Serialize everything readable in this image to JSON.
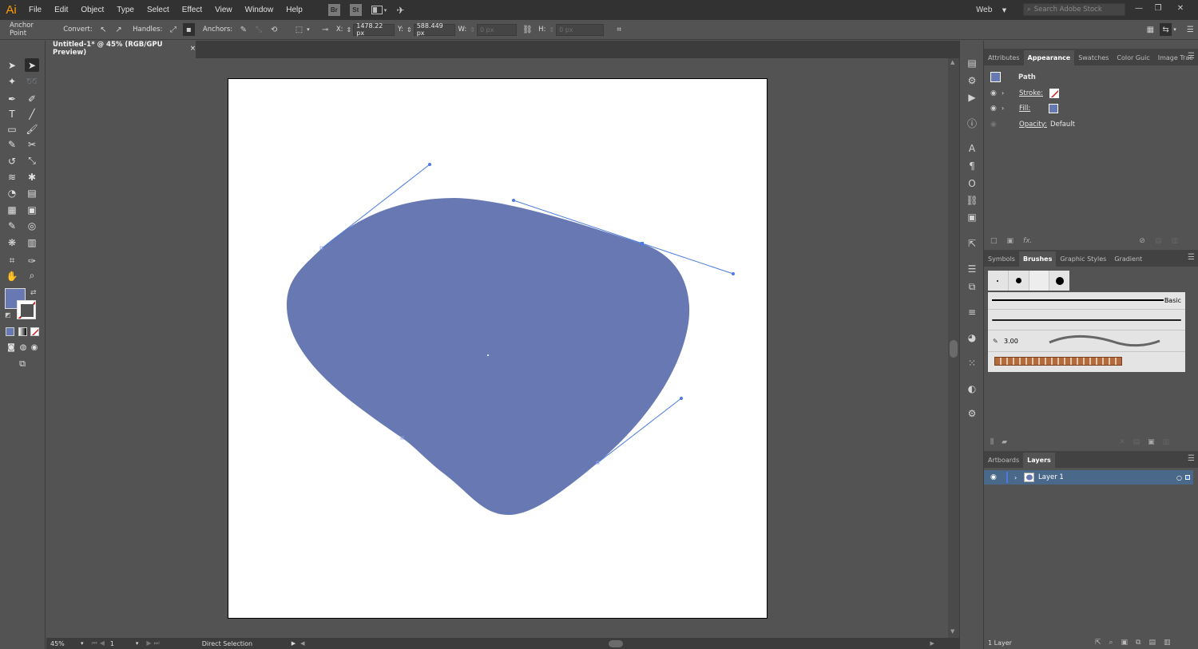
{
  "app": {
    "logo": "Ai",
    "accent": "#ff9a00"
  },
  "menu": [
    "File",
    "Edit",
    "Object",
    "Type",
    "Select",
    "Effect",
    "View",
    "Window",
    "Help"
  ],
  "menu_icons": {
    "bridge": "Br",
    "stock": "St"
  },
  "workspace": {
    "label": "Web"
  },
  "search": {
    "placeholder": "Search Adobe Stock"
  },
  "control": {
    "mode": "Anchor Point",
    "convert_label": "Convert:",
    "handles_label": "Handles:",
    "anchors_label": "Anchors:",
    "x_label": "X:",
    "x_value": "1478.22 px",
    "y_label": "Y:",
    "y_value": "588.449 px",
    "w_label": "W:",
    "w_value": "0 px",
    "h_label": "H:",
    "h_value": "0 px"
  },
  "document": {
    "tab_title": "Untitled-1* @ 45% (RGB/GPU Preview)",
    "close": "×",
    "fill_color": "#6878b3",
    "handle_color": "#4a7be0"
  },
  "status": {
    "zoom": "45%",
    "artboard_num": "1",
    "tool": "Direct Selection"
  },
  "appearance_panel": {
    "tabs": [
      "Attributes",
      "Appearance",
      "Swatches",
      "Color Guic",
      "Image Trac"
    ],
    "active_tab": "Appearance",
    "object": "Path",
    "stroke_label": "Stroke:",
    "fill_label": "Fill:",
    "opacity_label": "Opacity:",
    "opacity_value": "Default"
  },
  "brushes_panel": {
    "tabs": [
      "Symbols",
      "Brushes",
      "Graphic Styles",
      "Gradient"
    ],
    "active_tab": "Brushes",
    "basic_label": "Basic",
    "size_label": "3.00"
  },
  "layers_panel": {
    "tabs": [
      "Artboards",
      "Layers"
    ],
    "active_tab": "Layers",
    "layer_name": "Layer 1",
    "count": "1 Layer"
  }
}
